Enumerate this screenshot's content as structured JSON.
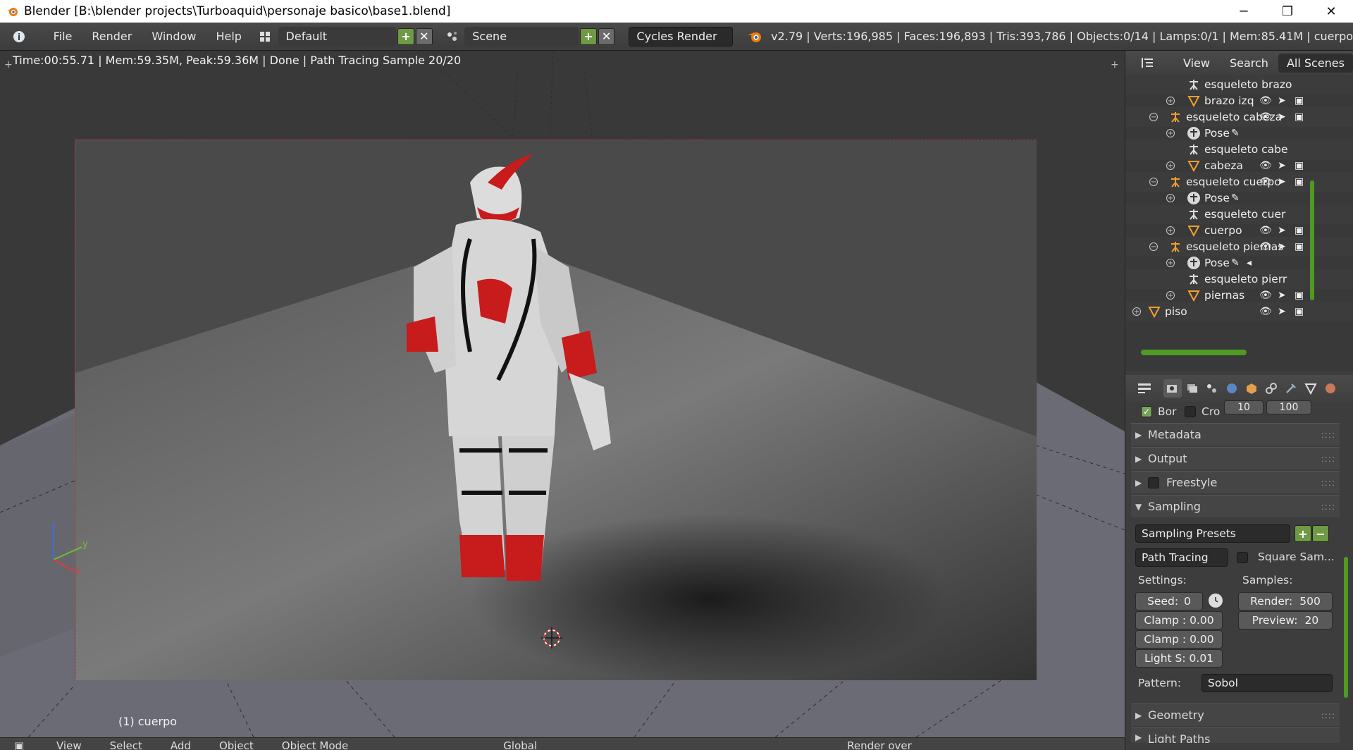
{
  "window": {
    "title": "Blender [B:\\blender projects\\Turboaquid\\personaje basico\\base1.blend]",
    "minimize": "─",
    "maximize": "❐",
    "close": "✕"
  },
  "infobar": {
    "menus": [
      "File",
      "Render",
      "Window",
      "Help"
    ],
    "screen_layout": "Default",
    "scene": "Scene",
    "render_engine": "Cycles Render",
    "stats": "v2.79 | Verts:196,985 | Faces:196,893 | Tris:393,786 | Objects:0/14 | Lamps:0/1 | Mem:85.41M | cuerpo"
  },
  "viewport": {
    "render_status": "Time:00:55.71 | Mem:59.35M, Peak:59.36M | Done | Path Tracing Sample 20/20",
    "object_label": "(1) cuerpo",
    "axis_x": "x",
    "axis_y": "y"
  },
  "bottombar": {
    "items": [
      "View",
      "Select",
      "Add",
      "Object",
      "Object Mode",
      "Global",
      "Render over"
    ]
  },
  "outliner": {
    "header_tabs": [
      "View",
      "Search",
      "All Scenes"
    ],
    "rows": [
      {
        "label": "esqueleto brazo",
        "type": "armature-data"
      },
      {
        "label": "brazo izq",
        "type": "mesh"
      },
      {
        "label": "esqueleto cabeza",
        "type": "armature"
      },
      {
        "label": "Pose",
        "type": "pose"
      },
      {
        "label": "esqueleto cabe",
        "type": "armature-data"
      },
      {
        "label": "cabeza",
        "type": "mesh"
      },
      {
        "label": "esqueleto cuerpo",
        "type": "armature"
      },
      {
        "label": "Pose",
        "type": "pose"
      },
      {
        "label": "esqueleto cuer",
        "type": "armature-data"
      },
      {
        "label": "cuerpo",
        "type": "mesh"
      },
      {
        "label": "esqueleto piernas",
        "type": "armature"
      },
      {
        "label": "Pose",
        "type": "pose"
      },
      {
        "label": "esqueleto pierr",
        "type": "armature-data"
      },
      {
        "label": "piernas",
        "type": "mesh"
      },
      {
        "label": "piso",
        "type": "mesh"
      }
    ]
  },
  "properties": {
    "border_label": "Bor",
    "crop_label": "Cro",
    "res_a": "10",
    "res_b": "100",
    "panels": {
      "metadata": "Metadata",
      "output": "Output",
      "freestyle": "Freestyle",
      "sampling": "Sampling",
      "geometry": "Geometry",
      "light_paths": "Light Paths"
    },
    "sampling": {
      "presets": "Sampling Presets",
      "integrator": "Path Tracing",
      "square_samples": "Square Sam...",
      "settings_label": "Settings:",
      "samples_label": "Samples:",
      "seed": "Seed:",
      "seed_value": "0",
      "clamp_direct": "Clamp : 0.00",
      "clamp_indirect": "Clamp : 0.00",
      "light_sampling": "Light S: 0.01",
      "render": "Render:",
      "render_value": "500",
      "preview": "Preview:",
      "preview_value": "20",
      "pattern_label": "Pattern:",
      "pattern_value": "Sobol"
    }
  },
  "colors": {
    "accent_green": "#6f9a43",
    "camera_border": "#b9323b",
    "mesh_icon": "#f0a030"
  }
}
